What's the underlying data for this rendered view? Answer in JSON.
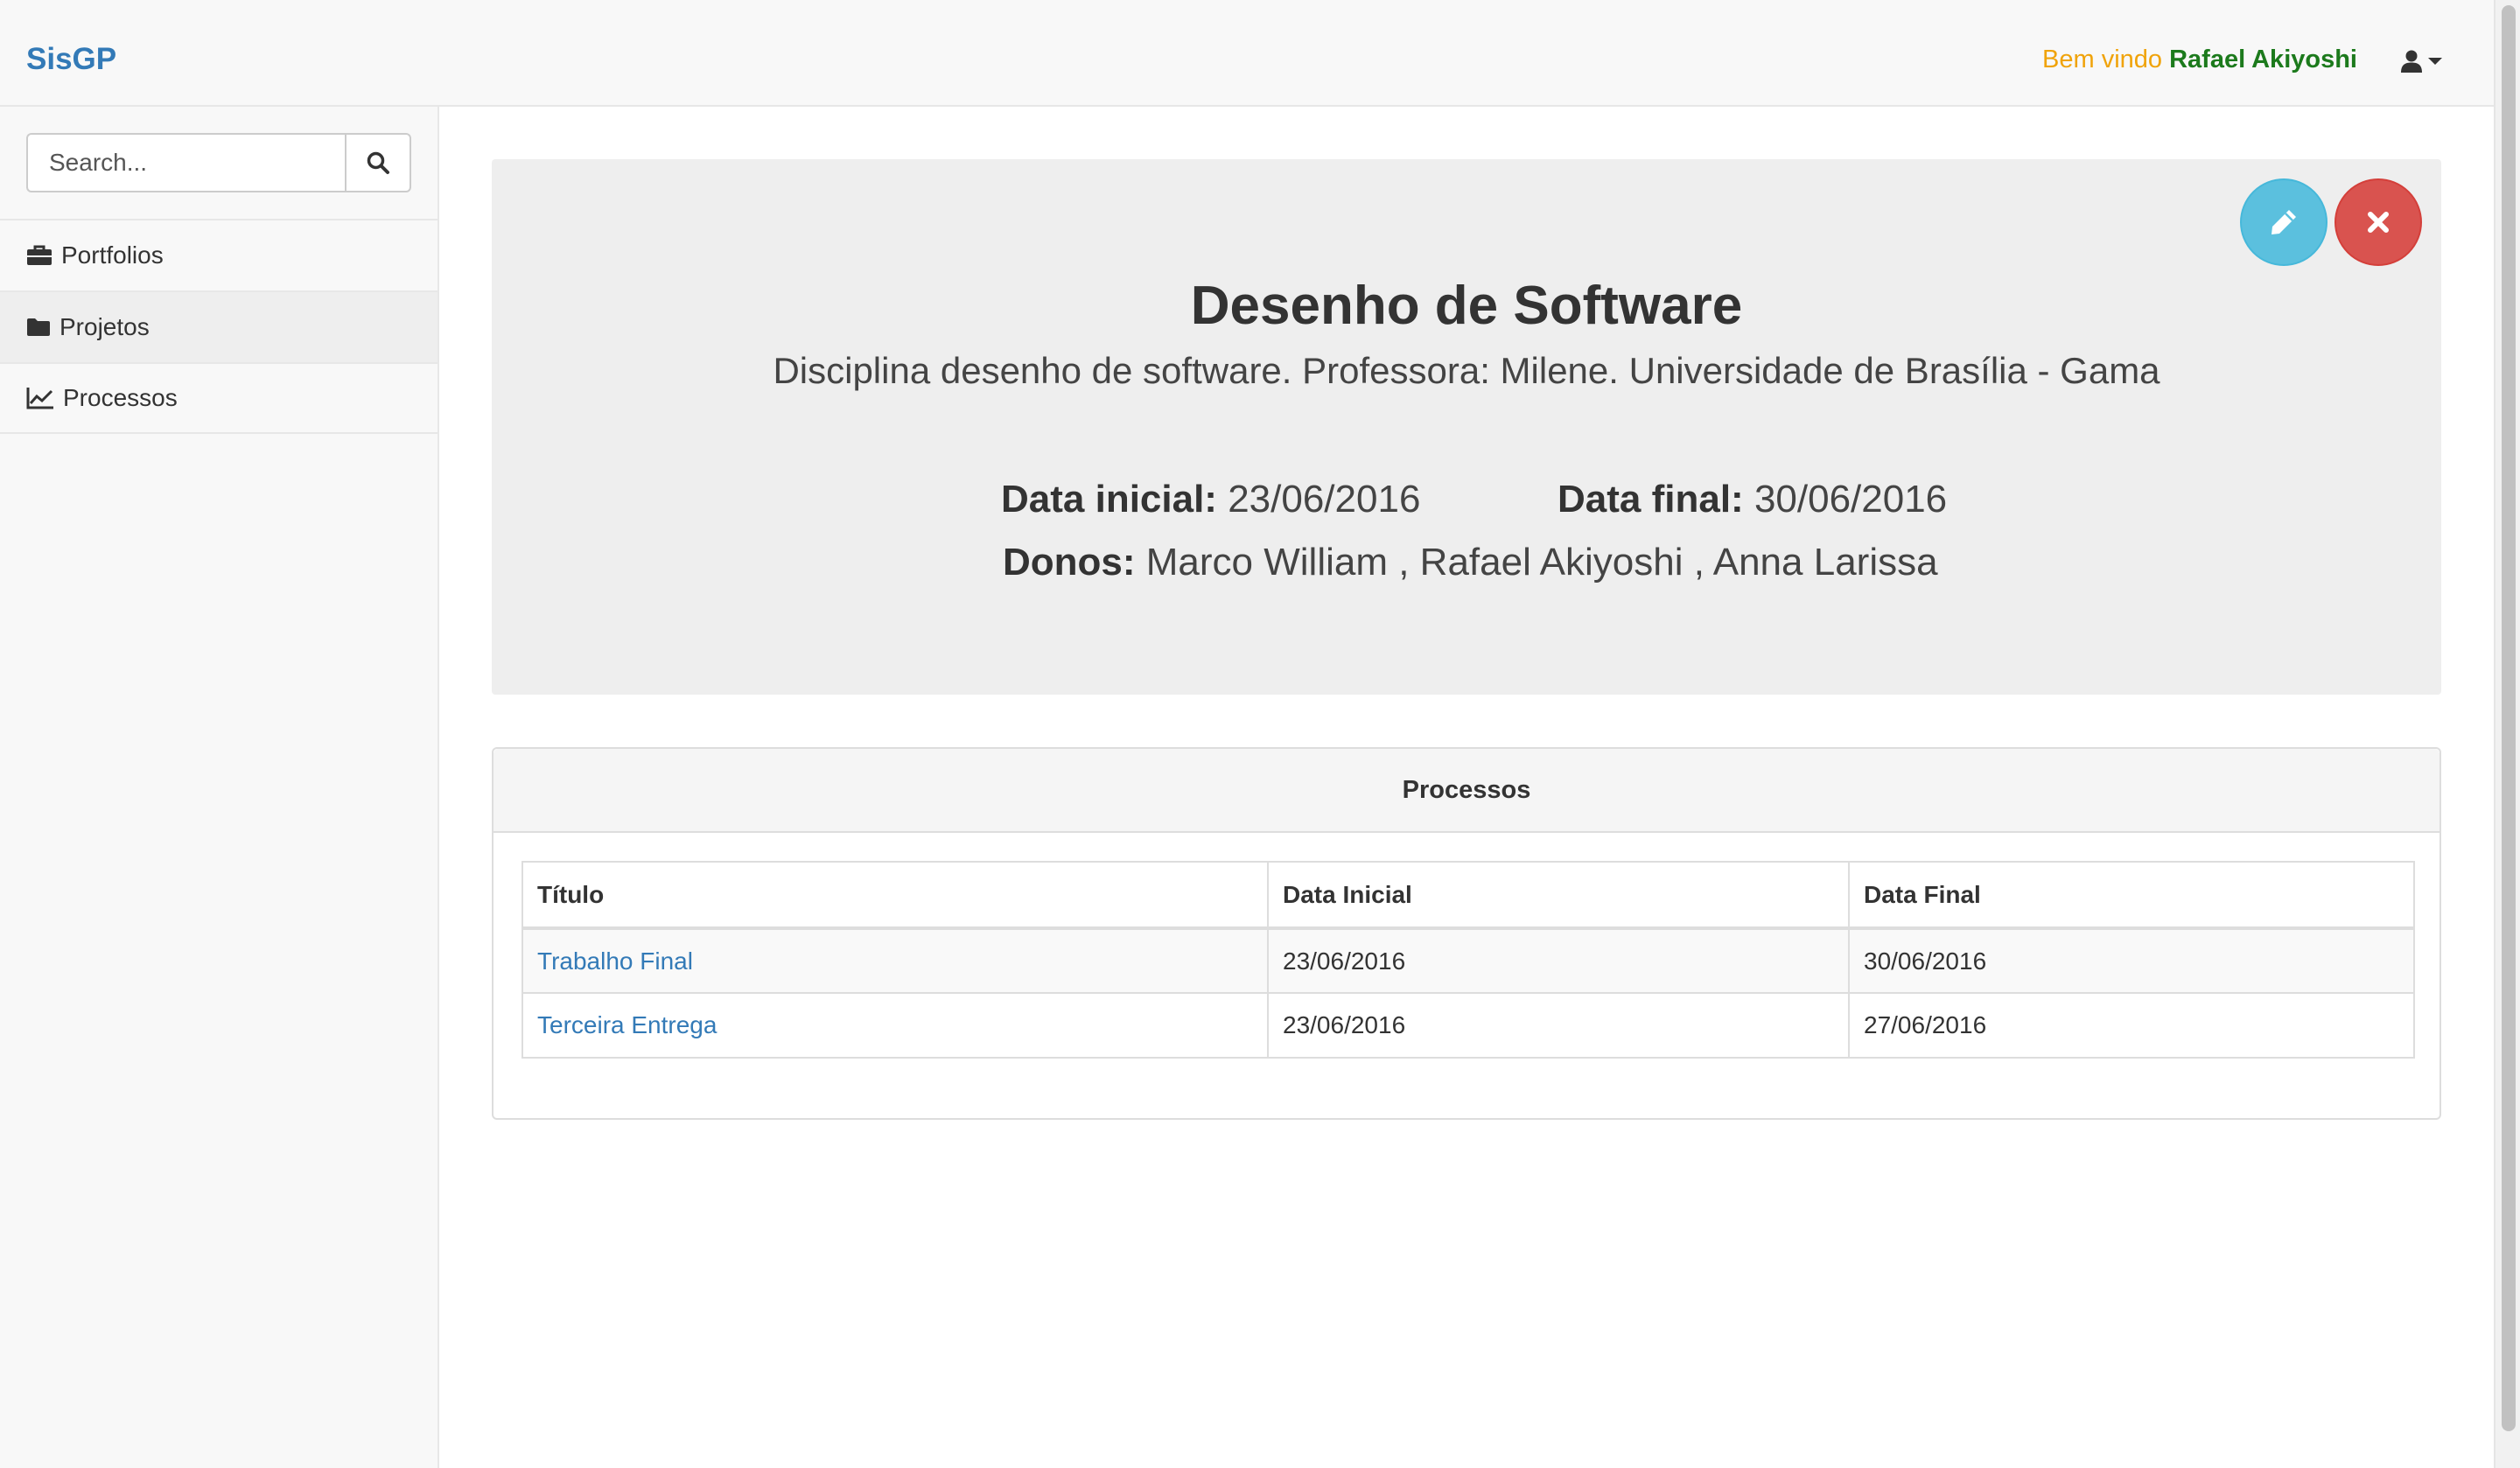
{
  "navbar": {
    "brand": "SisGP",
    "welcome_prefix": "Bem vindo",
    "user_name": "Rafael Akiyoshi"
  },
  "sidebar": {
    "search_placeholder": "Search...",
    "items": [
      {
        "label": "Portfolios",
        "icon": "briefcase-icon"
      },
      {
        "label": "Projetos",
        "icon": "folder-icon",
        "active": true
      },
      {
        "label": "Processos",
        "icon": "line-chart-icon"
      }
    ]
  },
  "project": {
    "title": "Desenho de Software",
    "description": "Disciplina desenho de software. Professora: Milene. Universidade de Brasília - Gama",
    "start_label": "Data inicial:",
    "start_value": "23/06/2016",
    "end_label": "Data final:",
    "end_value": "30/06/2016",
    "owners_label": "Donos:",
    "owners_value": "Marco William , Rafael Akiyoshi , Anna Larissa"
  },
  "processes": {
    "heading": "Processos",
    "columns": [
      "Título",
      "Data Inicial",
      "Data Final"
    ],
    "rows": [
      {
        "title": "Trabalho Final",
        "start": "23/06/2016",
        "end": "30/06/2016"
      },
      {
        "title": "Terceira Entrega",
        "start": "23/06/2016",
        "end": "27/06/2016"
      }
    ]
  },
  "colors": {
    "brand": "#337ab7",
    "welcome": "#f0a30a",
    "username": "#1c7a1c",
    "edit_button": "#5bc0de",
    "delete_button": "#d9534f"
  }
}
